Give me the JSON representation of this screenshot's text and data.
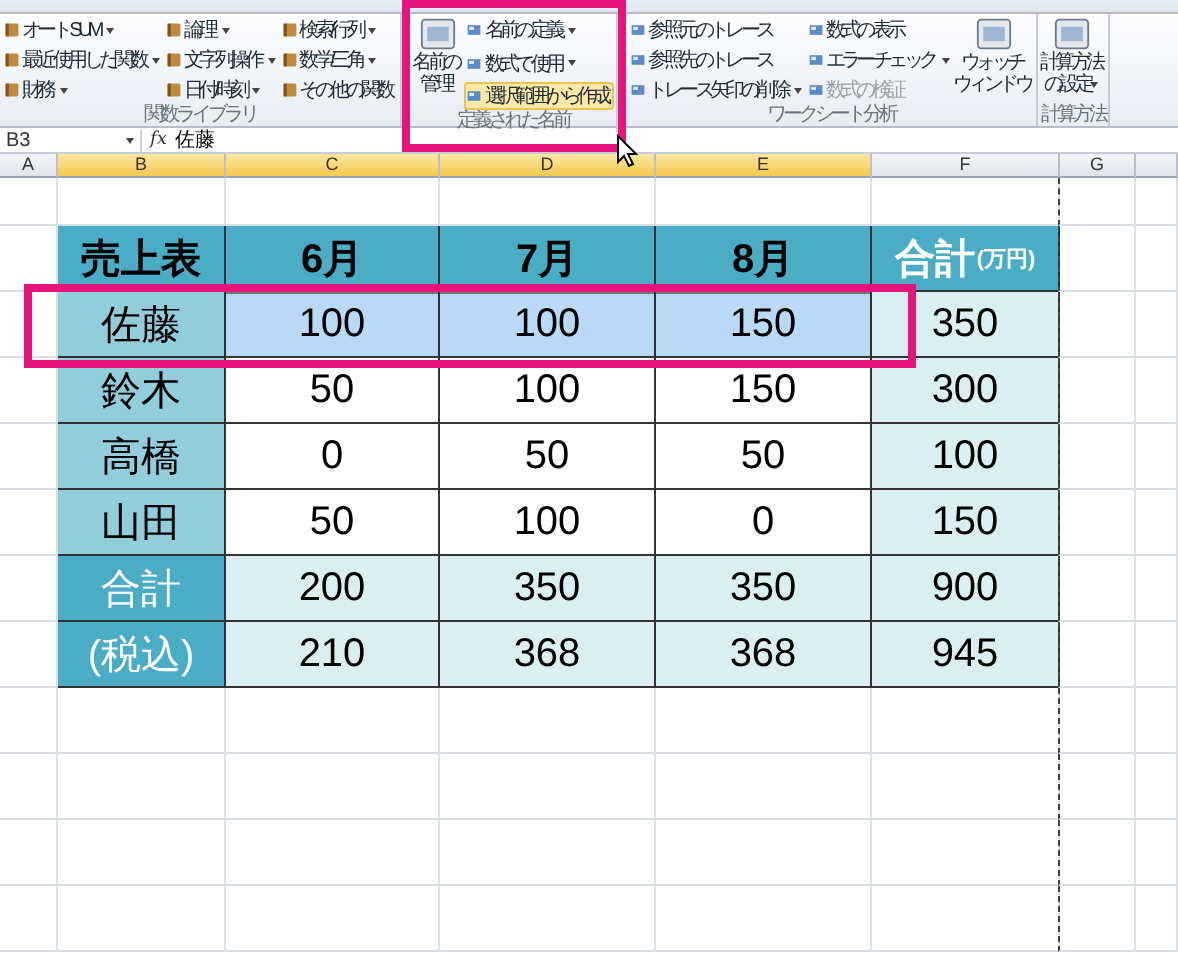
{
  "ribbon": {
    "groups": [
      {
        "label": "関数ライブラリ",
        "columns": [
          [
            {
              "label": "オート SUM",
              "dropdown": true,
              "disabled": false,
              "hovered": false
            },
            {
              "label": "最近使用した関数",
              "dropdown": true,
              "disabled": false,
              "hovered": false
            },
            {
              "label": "財務",
              "dropdown": true,
              "disabled": false,
              "hovered": false
            }
          ],
          [
            {
              "label": "論理",
              "dropdown": true,
              "disabled": false,
              "hovered": false
            },
            {
              "label": "文字列操作",
              "dropdown": true,
              "disabled": false,
              "hovered": false
            },
            {
              "label": "日付/時刻",
              "dropdown": true,
              "disabled": false,
              "hovered": false
            }
          ],
          [
            {
              "label": "検索/行列",
              "dropdown": true,
              "disabled": false,
              "hovered": false
            },
            {
              "label": "数学/三角",
              "dropdown": true,
              "disabled": false,
              "hovered": false
            },
            {
              "label": "その他の関数",
              "dropdown": false,
              "disabled": false,
              "hovered": false
            }
          ]
        ]
      },
      {
        "label": "定義された名前",
        "large": [
          {
            "lines": [
              "名前の",
              "管理"
            ],
            "dropdown": false
          }
        ],
        "columns": [
          [
            {
              "label": "名前の定義",
              "dropdown": true,
              "disabled": false,
              "hovered": false
            },
            {
              "label": "数式で使用",
              "dropdown": true,
              "disabled": false,
              "hovered": false
            },
            {
              "label": "選択範囲から作成",
              "dropdown": false,
              "disabled": false,
              "hovered": true
            }
          ]
        ]
      },
      {
        "label": "ワークシート分析",
        "columns": [
          [
            {
              "label": "参照元のトレース",
              "dropdown": false,
              "disabled": false,
              "hovered": false
            },
            {
              "label": "参照先のトレース",
              "dropdown": false,
              "disabled": false,
              "hovered": false
            },
            {
              "label": "トレース矢印の削除",
              "dropdown": true,
              "disabled": false,
              "hovered": false
            }
          ],
          [
            {
              "label": "数式の表示",
              "dropdown": false,
              "disabled": false,
              "hovered": false
            },
            {
              "label": "エラー チェック",
              "dropdown": true,
              "disabled": false,
              "hovered": false
            },
            {
              "label": "数式の検証",
              "dropdown": false,
              "disabled": true,
              "hovered": false
            }
          ]
        ],
        "trailing": [
          {
            "lines": [
              "ウォッチ",
              "ウィンドウ"
            ],
            "dropdown": false
          }
        ]
      },
      {
        "label": "計算方法",
        "large": [
          {
            "lines": [
              "計算方法",
              "の設定"
            ],
            "dropdown": true
          }
        ]
      }
    ]
  },
  "formula_bar": {
    "cell": "B3",
    "fx": "fx",
    "value": "佐藤"
  },
  "columns": [
    {
      "label": "A",
      "selected": false
    },
    {
      "label": "B",
      "selected": true
    },
    {
      "label": "C",
      "selected": true
    },
    {
      "label": "D",
      "selected": true
    },
    {
      "label": "E",
      "selected": true
    },
    {
      "label": "F",
      "selected": false
    },
    {
      "label": "G",
      "selected": false
    }
  ],
  "table": {
    "rows": [
      {
        "kind": "header",
        "cells": [
          {
            "text": "売上表",
            "selected": false
          },
          {
            "text": "6月",
            "selected": false
          },
          {
            "text": "7月",
            "selected": false
          },
          {
            "text": "8月",
            "selected": false
          },
          {
            "text": "合計",
            "unit": "(万円)",
            "selected": false
          }
        ]
      },
      {
        "kind": "body",
        "cells": [
          {
            "text": "佐藤",
            "selected": false
          },
          {
            "text": "100",
            "selected": true
          },
          {
            "text": "100",
            "selected": true
          },
          {
            "text": "150",
            "selected": true
          },
          {
            "text": "350",
            "selected": false
          }
        ]
      },
      {
        "kind": "body",
        "cells": [
          {
            "text": "鈴木",
            "selected": false
          },
          {
            "text": "50",
            "selected": false
          },
          {
            "text": "100",
            "selected": false
          },
          {
            "text": "150",
            "selected": false
          },
          {
            "text": "300",
            "selected": false
          }
        ]
      },
      {
        "kind": "body",
        "cells": [
          {
            "text": "高橋",
            "selected": false
          },
          {
            "text": "0",
            "selected": false
          },
          {
            "text": "50",
            "selected": false
          },
          {
            "text": "50",
            "selected": false
          },
          {
            "text": "100",
            "selected": false
          }
        ]
      },
      {
        "kind": "body",
        "cells": [
          {
            "text": "山田",
            "selected": false
          },
          {
            "text": "50",
            "selected": false
          },
          {
            "text": "100",
            "selected": false
          },
          {
            "text": "0",
            "selected": false
          },
          {
            "text": "150",
            "selected": false
          }
        ]
      },
      {
        "kind": "total",
        "cells": [
          {
            "text": "合計",
            "selected": false
          },
          {
            "text": "200",
            "selected": false
          },
          {
            "text": "350",
            "selected": false
          },
          {
            "text": "350",
            "selected": false
          },
          {
            "text": "900",
            "selected": false
          }
        ]
      },
      {
        "kind": "total",
        "cells": [
          {
            "text": "(税込)",
            "selected": false
          },
          {
            "text": "210",
            "selected": false
          },
          {
            "text": "368",
            "selected": false
          },
          {
            "text": "368",
            "selected": false
          },
          {
            "text": "945",
            "selected": false
          }
        ]
      }
    ]
  }
}
